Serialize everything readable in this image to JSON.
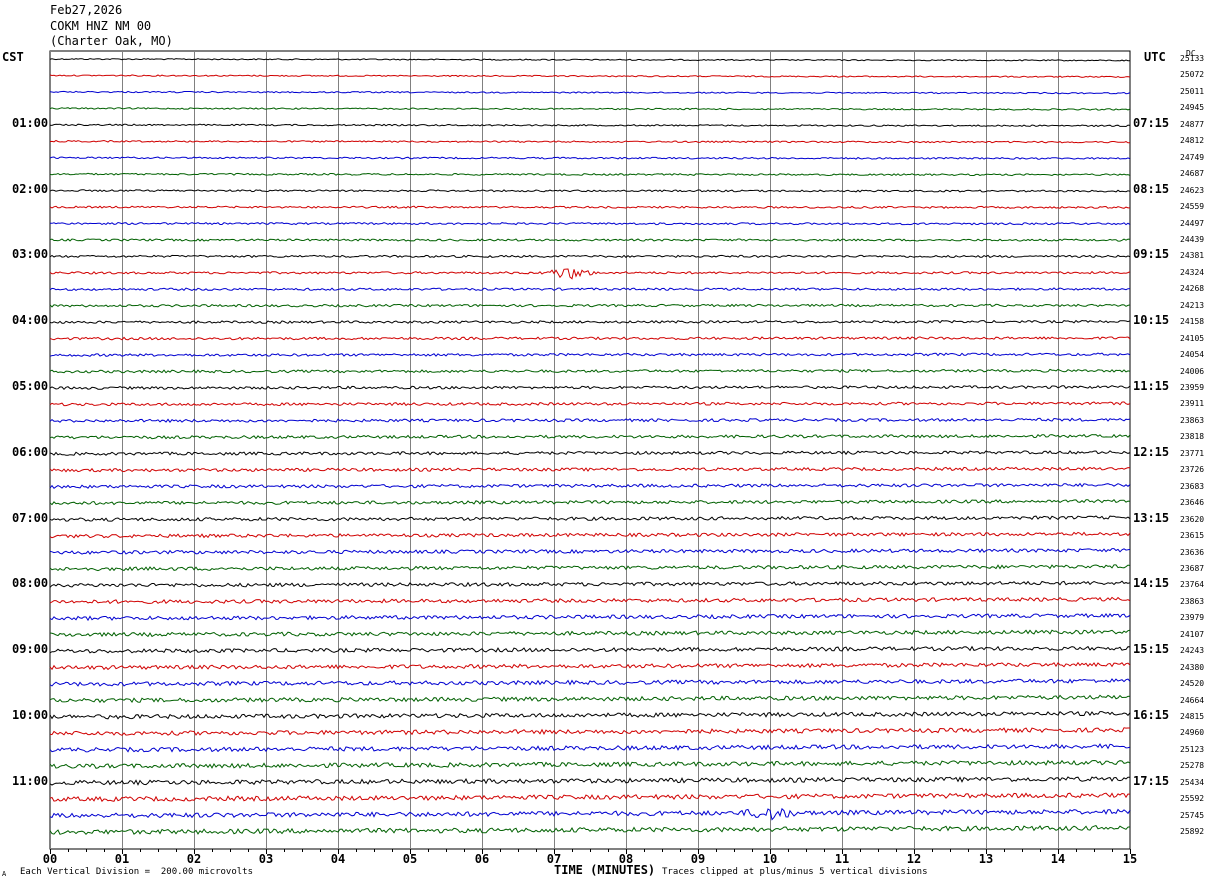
{
  "header": {
    "date": "Feb27,2026",
    "station": "COKM HNZ NM 00",
    "location": "(Charter Oak, MO)"
  },
  "left_tz": "CST",
  "right_tz": "UTC",
  "dc_label": "DC",
  "footer": {
    "scale_mark": "A",
    "scale_text": "Each Vertical Division =  200.00 microvolts",
    "xlabel": "TIME (MINUTES)",
    "clip_text": "Traces clipped at plus/minus 5 vertical divisions"
  },
  "colors": {
    "trace_cycle": [
      "#000000",
      "#d00000",
      "#0000d0",
      "#006000"
    ],
    "grid": "#808080"
  },
  "chart_data": {
    "type": "line",
    "title": "COKM HNZ NM 00",
    "xlabel": "TIME (MINUTES)",
    "xlim": [
      0,
      15
    ],
    "x_ticks": [
      "00",
      "01",
      "02",
      "03",
      "04",
      "05",
      "06",
      "07",
      "08",
      "09",
      "10",
      "11",
      "12",
      "13",
      "14",
      "15"
    ],
    "left_hour_labels": [
      "01:00",
      "02:00",
      "03:00",
      "04:00",
      "05:00",
      "06:00",
      "07:00",
      "08:00",
      "09:00",
      "10:00",
      "11:00"
    ],
    "right_hour_labels": [
      "07:15",
      "08:15",
      "09:15",
      "10:15",
      "11:15",
      "12:15",
      "13:15",
      "14:15",
      "15:15",
      "16:15",
      "17:15"
    ],
    "dc_offsets": [
      25133,
      25072,
      25011,
      24945,
      24877,
      24812,
      24749,
      24687,
      24623,
      24559,
      24497,
      24439,
      24381,
      24324,
      24268,
      24213,
      24158,
      24105,
      24054,
      24006,
      23959,
      23911,
      23863,
      23818,
      23771,
      23726,
      23683,
      23646,
      23620,
      23615,
      23636,
      23687,
      23764,
      23863,
      23979,
      24107,
      24243,
      24380,
      24520,
      24664,
      24815,
      24960,
      25123,
      25278,
      25434,
      25592,
      25745,
      25892
    ],
    "grid": true,
    "events": [
      {
        "trace": 13,
        "minute": 7.2,
        "label": ""
      },
      {
        "trace": 46,
        "minute": 10.0,
        "label": ""
      }
    ]
  }
}
